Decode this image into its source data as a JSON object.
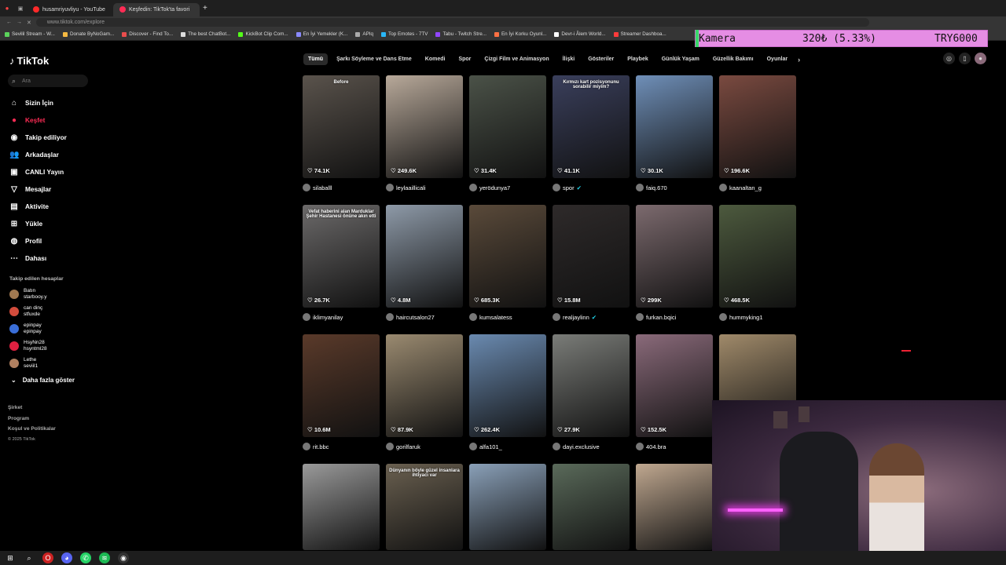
{
  "browser": {
    "tabs": [
      {
        "label": "husamriyuvliyu - YouTube",
        "color": "#ff2a2a"
      },
      {
        "label": "Keşfedin: TikTok'ta favori",
        "color": "#fe2c55"
      }
    ],
    "new_tab": "+",
    "url": "www.tiktok.com/explore",
    "bookmarks": [
      {
        "label": "Sevilil Stream - W...",
        "color": "#5bd35b"
      },
      {
        "label": "Donate ByNoGam...",
        "color": "#f5b942"
      },
      {
        "label": "Discover - Find To...",
        "color": "#e94d4d"
      },
      {
        "label": "The best ChatBot...",
        "color": "#dddddd"
      },
      {
        "label": "KickBot Clip Com...",
        "color": "#53fc18"
      },
      {
        "label": "En İyi Yemekler (K...",
        "color": "#8a8aff"
      },
      {
        "label": "APIq",
        "color": "#aaaaaa"
      },
      {
        "label": "Top Emotes - 7TV",
        "color": "#29b6f6"
      },
      {
        "label": "Tabu - Twitch Stre...",
        "color": "#9146ff"
      },
      {
        "label": "En İyi Korku Oyunl...",
        "color": "#ff7043"
      },
      {
        "label": "Devr-i Âlem World...",
        "color": "#ffffff"
      },
      {
        "label": "Streamer Dashboa...",
        "color": "#ff3b3b"
      }
    ]
  },
  "overlay": {
    "label": "Kamera",
    "value": "320₺ (5.33%)",
    "goal": "TRY6000",
    "bar_color": "#e58de4",
    "progress_color": "#39d86a"
  },
  "sidebar": {
    "logo": "TikTok",
    "search_placeholder": "Ara",
    "nav": [
      {
        "label": "Sizin İçin",
        "icon": "home-icon",
        "glyph": "⌂",
        "active": false
      },
      {
        "label": "Keşfet",
        "icon": "compass-icon",
        "glyph": "●",
        "active": true
      },
      {
        "label": "Takip ediliyor",
        "icon": "following-icon",
        "glyph": "◉",
        "active": false
      },
      {
        "label": "Arkadaşlar",
        "icon": "friends-icon",
        "glyph": "👥",
        "active": false
      },
      {
        "label": "CANLI Yayın",
        "icon": "live-icon",
        "glyph": "▣",
        "active": false
      },
      {
        "label": "Mesajlar",
        "icon": "messages-icon",
        "glyph": "▽",
        "active": false
      },
      {
        "label": "Aktivite",
        "icon": "activity-icon",
        "glyph": "▤",
        "active": false
      },
      {
        "label": "Yükle",
        "icon": "upload-icon",
        "glyph": "⊞",
        "active": false
      },
      {
        "label": "Profil",
        "icon": "profile-icon",
        "glyph": "◍",
        "active": false
      },
      {
        "label": "Dahası",
        "icon": "more-icon",
        "glyph": "⋯",
        "active": false
      }
    ],
    "following_header": "Takip edilen hesaplar",
    "following": [
      {
        "name": "Batın",
        "handle": "starbooy.y",
        "color": "#a07850"
      },
      {
        "name": "can dinç",
        "handle": "stfuxde",
        "color": "#d34c3c"
      },
      {
        "name": "epinpay",
        "handle": "epinpay",
        "color": "#3a6ed8"
      },
      {
        "name": "HsyNn28",
        "handle": "hsyntml28",
        "color": "#e02040"
      },
      {
        "name": "Lethe",
        "handle": "seviil1",
        "color": "#b08060"
      }
    ],
    "more_accounts": "Daha fazla göster",
    "footer": [
      "Şirket",
      "Program",
      "Koşul ve Politikalar"
    ],
    "copyright": "© 2025 TikTok"
  },
  "categories": [
    "Tümü",
    "Şarkı Söyleme ve Dans Etme",
    "Komedi",
    "Spor",
    "Çizgi Film ve Animasyon",
    "İlişki",
    "Gösteriler",
    "Playbek",
    "Günlük Yaşam",
    "Güzellik Bakımı",
    "Oyunlar"
  ],
  "videos": [
    {
      "views": "74.1K",
      "user": "silaballl",
      "bg": "#5a534c",
      "cap": "Before"
    },
    {
      "views": "249.6K",
      "user": "leylaaillicali",
      "bg": "#b8a99a",
      "cap": ""
    },
    {
      "views": "31.4K",
      "user": "yerödunya7",
      "bg": "#4b5248",
      "cap": ""
    },
    {
      "views": "41.1K",
      "user": "spor",
      "bg": "#3a3f5c",
      "cap": "Kırmızı kart pozisyonunu sorabilir miyim?",
      "verified": true
    },
    {
      "views": "30.1K",
      "user": "faiq.670",
      "bg": "#6f8fb8",
      "cap": ""
    },
    {
      "views": "196.6K",
      "user": "kaanaltan_g",
      "bg": "#7a4a40",
      "cap": ""
    },
    {
      "views": "26.7K",
      "user": "iklimyanilay",
      "bg": "#6c6a6a",
      "cap": "Vefat haberini alan Marduklar Şehir Hastanesi önüne akın etti"
    },
    {
      "views": "4.8M",
      "user": "haircutsalon27",
      "bg": "#8e9aa8",
      "cap": ""
    },
    {
      "views": "685.3K",
      "user": "kumsalatess",
      "bg": "#5a4a3a",
      "cap": ""
    },
    {
      "views": "15.8M",
      "user": "realjaylinn",
      "bg": "#2e2a2a",
      "cap": "",
      "verified": true
    },
    {
      "views": "299K",
      "user": "furkan.bqici",
      "bg": "#7c6a6e",
      "cap": ""
    },
    {
      "views": "468.5K",
      "user": "hummyking1",
      "bg": "#4d5a3e",
      "cap": ""
    },
    {
      "views": "10.6M",
      "user": "rit.bbc",
      "bg": "#5a3a2a",
      "cap": ""
    },
    {
      "views": "87.9K",
      "user": "gorilfaruk",
      "bg": "#9a8a70",
      "cap": ""
    },
    {
      "views": "262.4K",
      "user": "alfa101_",
      "bg": "#6a8ab0",
      "cap": ""
    },
    {
      "views": "27.9K",
      "user": "dayi.exclusive",
      "bg": "#7a7c78",
      "cap": ""
    },
    {
      "views": "152.5K",
      "user": "404.bra",
      "bg": "#8a6a7a",
      "cap": ""
    },
    {
      "views": "",
      "user": "",
      "bg": "#a08a6a",
      "cap": ""
    },
    {
      "views": "",
      "user": "",
      "bg": "#9a9a9a",
      "cap": ""
    },
    {
      "views": "",
      "user": "",
      "bg": "#6a6050",
      "cap": "Dünyanın böyle güzel insanlara ihtiyacı var"
    },
    {
      "views": "",
      "user": "",
      "bg": "#8aa0b8",
      "cap": ""
    },
    {
      "views": "",
      "user": "",
      "bg": "#5a6a5a",
      "cap": ""
    },
    {
      "views": "",
      "user": "",
      "bg": "#c0a890",
      "cap": ""
    }
  ],
  "icons": {
    "heart": "♡",
    "chevron_right": "›",
    "search": "⌕",
    "verified": "✔"
  }
}
